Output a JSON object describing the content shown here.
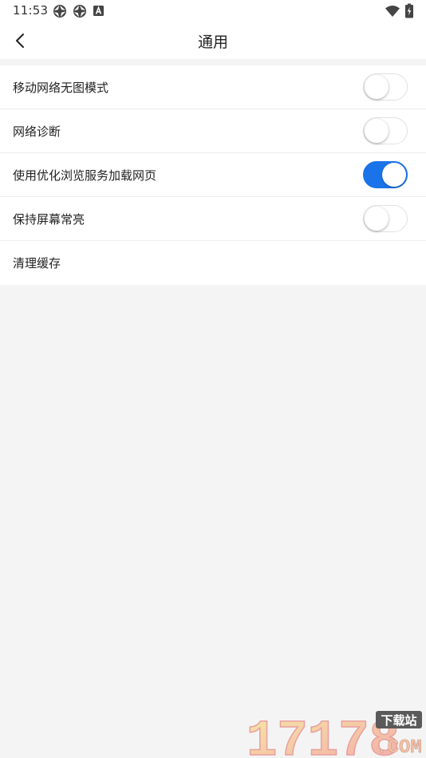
{
  "status_bar": {
    "time": "11:53",
    "icons": [
      "aperture-icon",
      "aperture-icon",
      "a-badge-icon",
      "wifi-icon",
      "battery-icon"
    ]
  },
  "header": {
    "back_icon": "chevron-left-icon",
    "title": "通用"
  },
  "settings": [
    {
      "label": "移动网络无图模式",
      "toggle": true,
      "on": false
    },
    {
      "label": "网络诊断",
      "toggle": true,
      "on": false
    },
    {
      "label": "使用优化浏览服务加载网页",
      "toggle": true,
      "on": true
    },
    {
      "label": "保持屏幕常亮",
      "toggle": true,
      "on": false
    },
    {
      "label": "清理缓存",
      "toggle": false
    }
  ],
  "watermark": {
    "number": "17178",
    "tag": "下载站",
    "domain": ".COM"
  },
  "colors": {
    "accent": "#1a73e8",
    "background": "#f4f4f4",
    "surface": "#ffffff"
  }
}
